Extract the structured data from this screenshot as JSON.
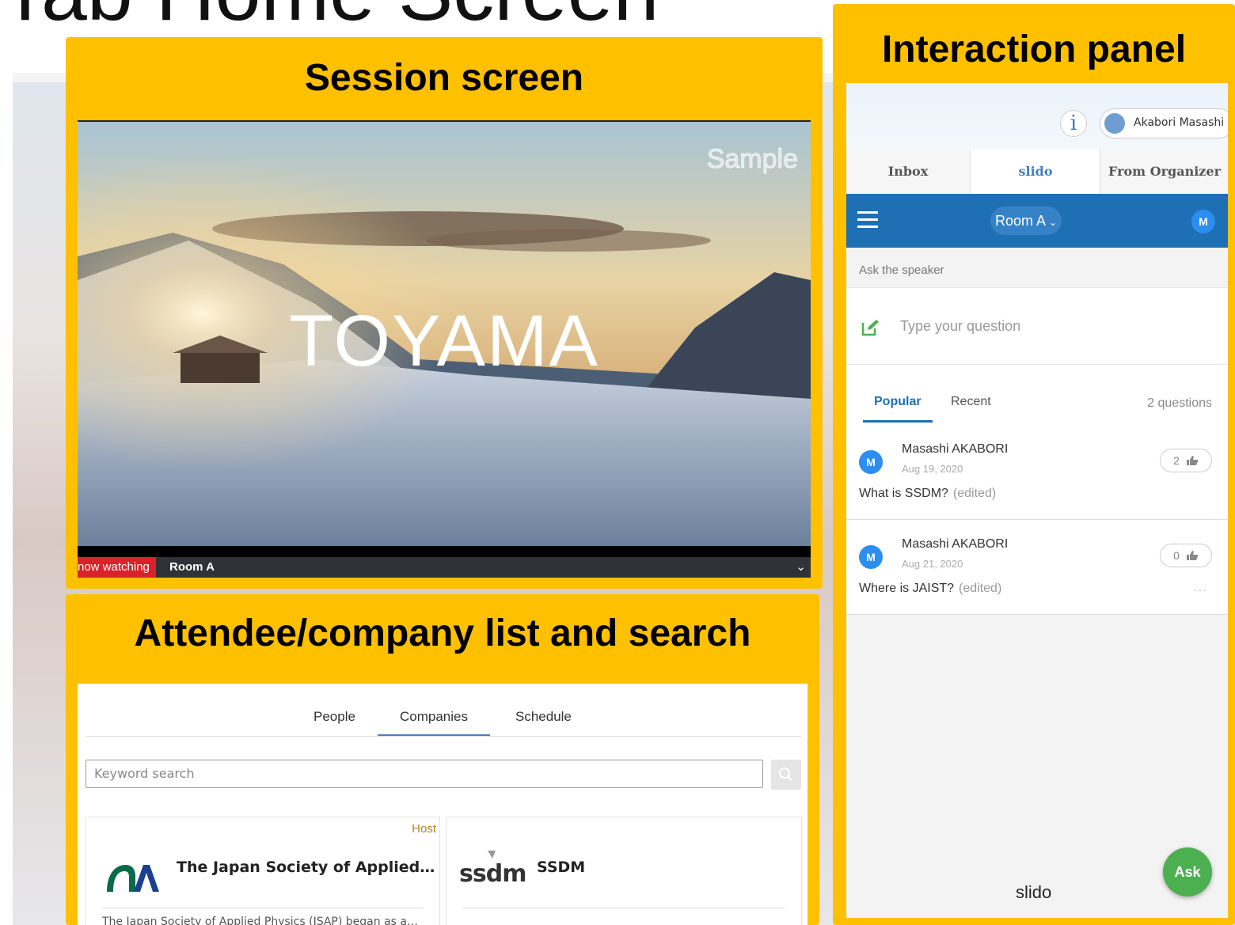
{
  "slide": {
    "title": "Tab Home Screen"
  },
  "callouts": {
    "session": "Session screen",
    "attendee": "Attendee/company list and search",
    "interaction": "Interaction panel"
  },
  "video": {
    "title": "TOYAMA",
    "watermark": "Sample",
    "now_watching": "now watching",
    "room": "Room A",
    "chevron": "⌄"
  },
  "attendee_panel": {
    "tabs": [
      "People",
      "Companies",
      "Schedule"
    ],
    "active_tab": "Companies",
    "search_placeholder": "Keyword search",
    "cards": [
      {
        "name": "The Japan Society of Applied…",
        "tag": "Host",
        "description": "The Japan Society of Applied Physics (JSAP) began as a…"
      },
      {
        "name": "SSDM",
        "logo_text": "ssdm"
      }
    ]
  },
  "interaction_panel": {
    "user_name": "Akabori Masashi",
    "info_glyph": "i",
    "tabs": [
      "Inbox",
      "slido",
      "From Organizer"
    ],
    "active_tab": "slido",
    "room": "Room A",
    "room_chevron": "⌄",
    "user_initial": "M",
    "ask_label": "Ask the speaker",
    "ask_placeholder": "Type your question",
    "question_tabs": [
      "Popular",
      "Recent"
    ],
    "question_count": "2 questions",
    "questions": [
      {
        "initial": "M",
        "author": "Masashi AKABORI",
        "date": "Aug 19, 2020",
        "text": "What is SSDM?",
        "edited": "(edited)",
        "likes": "2"
      },
      {
        "initial": "M",
        "author": "Masashi AKABORI",
        "date": "Aug 21, 2020",
        "text": "Where is JAIST?",
        "edited": "(edited)",
        "likes": "0",
        "more": "···"
      }
    ],
    "brand": "slido",
    "ask_button": "Ask",
    "colors": {
      "slido_blue": "#1f6fb4",
      "ask_green": "#4caf50",
      "avatar_blue": "#2b8ef0"
    }
  },
  "colors": {
    "callout": "#ffc000"
  }
}
